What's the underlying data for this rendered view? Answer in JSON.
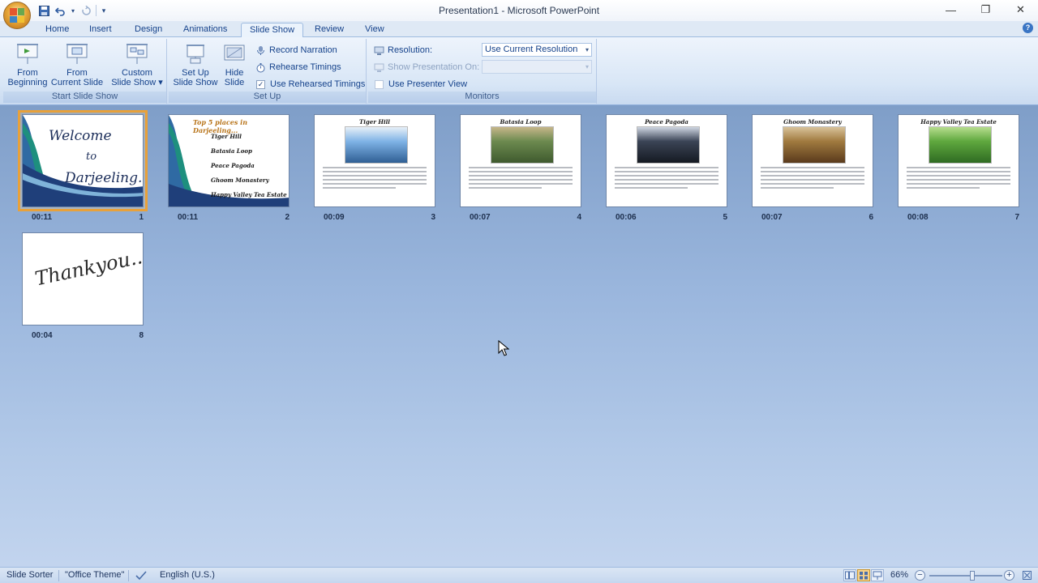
{
  "window": {
    "title": "Presentation1 - Microsoft PowerPoint",
    "minimize": "—",
    "restore": "❐",
    "close": "✕"
  },
  "qat": {
    "undo_drop": "▾",
    "customize": "▾"
  },
  "tabs": [
    {
      "label": "Home"
    },
    {
      "label": "Insert"
    },
    {
      "label": "Design"
    },
    {
      "label": "Animations"
    },
    {
      "label": "Slide Show"
    },
    {
      "label": "Review"
    },
    {
      "label": "View"
    }
  ],
  "help": "?",
  "ribbon": {
    "start_group": {
      "label": "Start Slide Show",
      "from_beginning": [
        "From",
        "Beginning"
      ],
      "from_current": [
        "From",
        "Current Slide"
      ],
      "custom": [
        "Custom",
        "Slide Show ▾"
      ]
    },
    "setup_group": {
      "label": "Set Up",
      "setup_show": [
        "Set Up",
        "Slide Show"
      ],
      "hide_slide": [
        "Hide",
        "Slide"
      ],
      "record_narration": "Record Narration",
      "rehearse_timings": "Rehearse Timings",
      "use_rehearsed": "Use Rehearsed Timings",
      "use_rehearsed_checked": "✓"
    },
    "monitors_group": {
      "label": "Monitors",
      "resolution_label": "Resolution:",
      "resolution_value": "Use Current Resolution",
      "show_on_label": "Show Presentation On:",
      "show_on_value": "",
      "presenter_view": "Use Presenter View",
      "combo_arrow": "▾"
    }
  },
  "slides": [
    {
      "num": "1",
      "time": "00:11",
      "selected": true,
      "welcome": [
        "Welcome",
        "to",
        "Darjeeling..."
      ]
    },
    {
      "num": "2",
      "time": "00:11",
      "title": "Top 5 places in Darjeeling...",
      "bullets": [
        "Tiger Hill",
        "Batasia Loop",
        "Peace Pagoda",
        "Ghoom Monastery",
        "Happy Valley Tea Estate"
      ]
    },
    {
      "num": "3",
      "time": "00:09",
      "title": "Tiger Hill",
      "photo": [
        "#7fb3e6",
        "#2f5f94",
        "#e8f0f8"
      ]
    },
    {
      "num": "4",
      "time": "00:07",
      "title": "Batasia Loop",
      "photo": [
        "#6c8a4f",
        "#3f5a2e",
        "#c6b68a"
      ]
    },
    {
      "num": "5",
      "time": "00:06",
      "title": "Peace Pagoda",
      "photo": [
        "#3b4456",
        "#151a22",
        "#cfd6e2"
      ]
    },
    {
      "num": "6",
      "time": "00:07",
      "title": "Ghoom Monastery",
      "photo": [
        "#a07a3f",
        "#5a3a1c",
        "#d8c29a"
      ]
    },
    {
      "num": "7",
      "time": "00:08",
      "title": "Happy Valley Tea Estate",
      "photo": [
        "#5fa83e",
        "#2f6b22",
        "#b7dd8e"
      ]
    },
    {
      "num": "8",
      "time": "00:04",
      "thanks": "Thankyou..."
    }
  ],
  "status": {
    "view": "Slide Sorter",
    "theme": "\"Office Theme\"",
    "language": "English (U.S.)",
    "zoom": "66%",
    "zoom_out": "−",
    "zoom_in": "+"
  }
}
